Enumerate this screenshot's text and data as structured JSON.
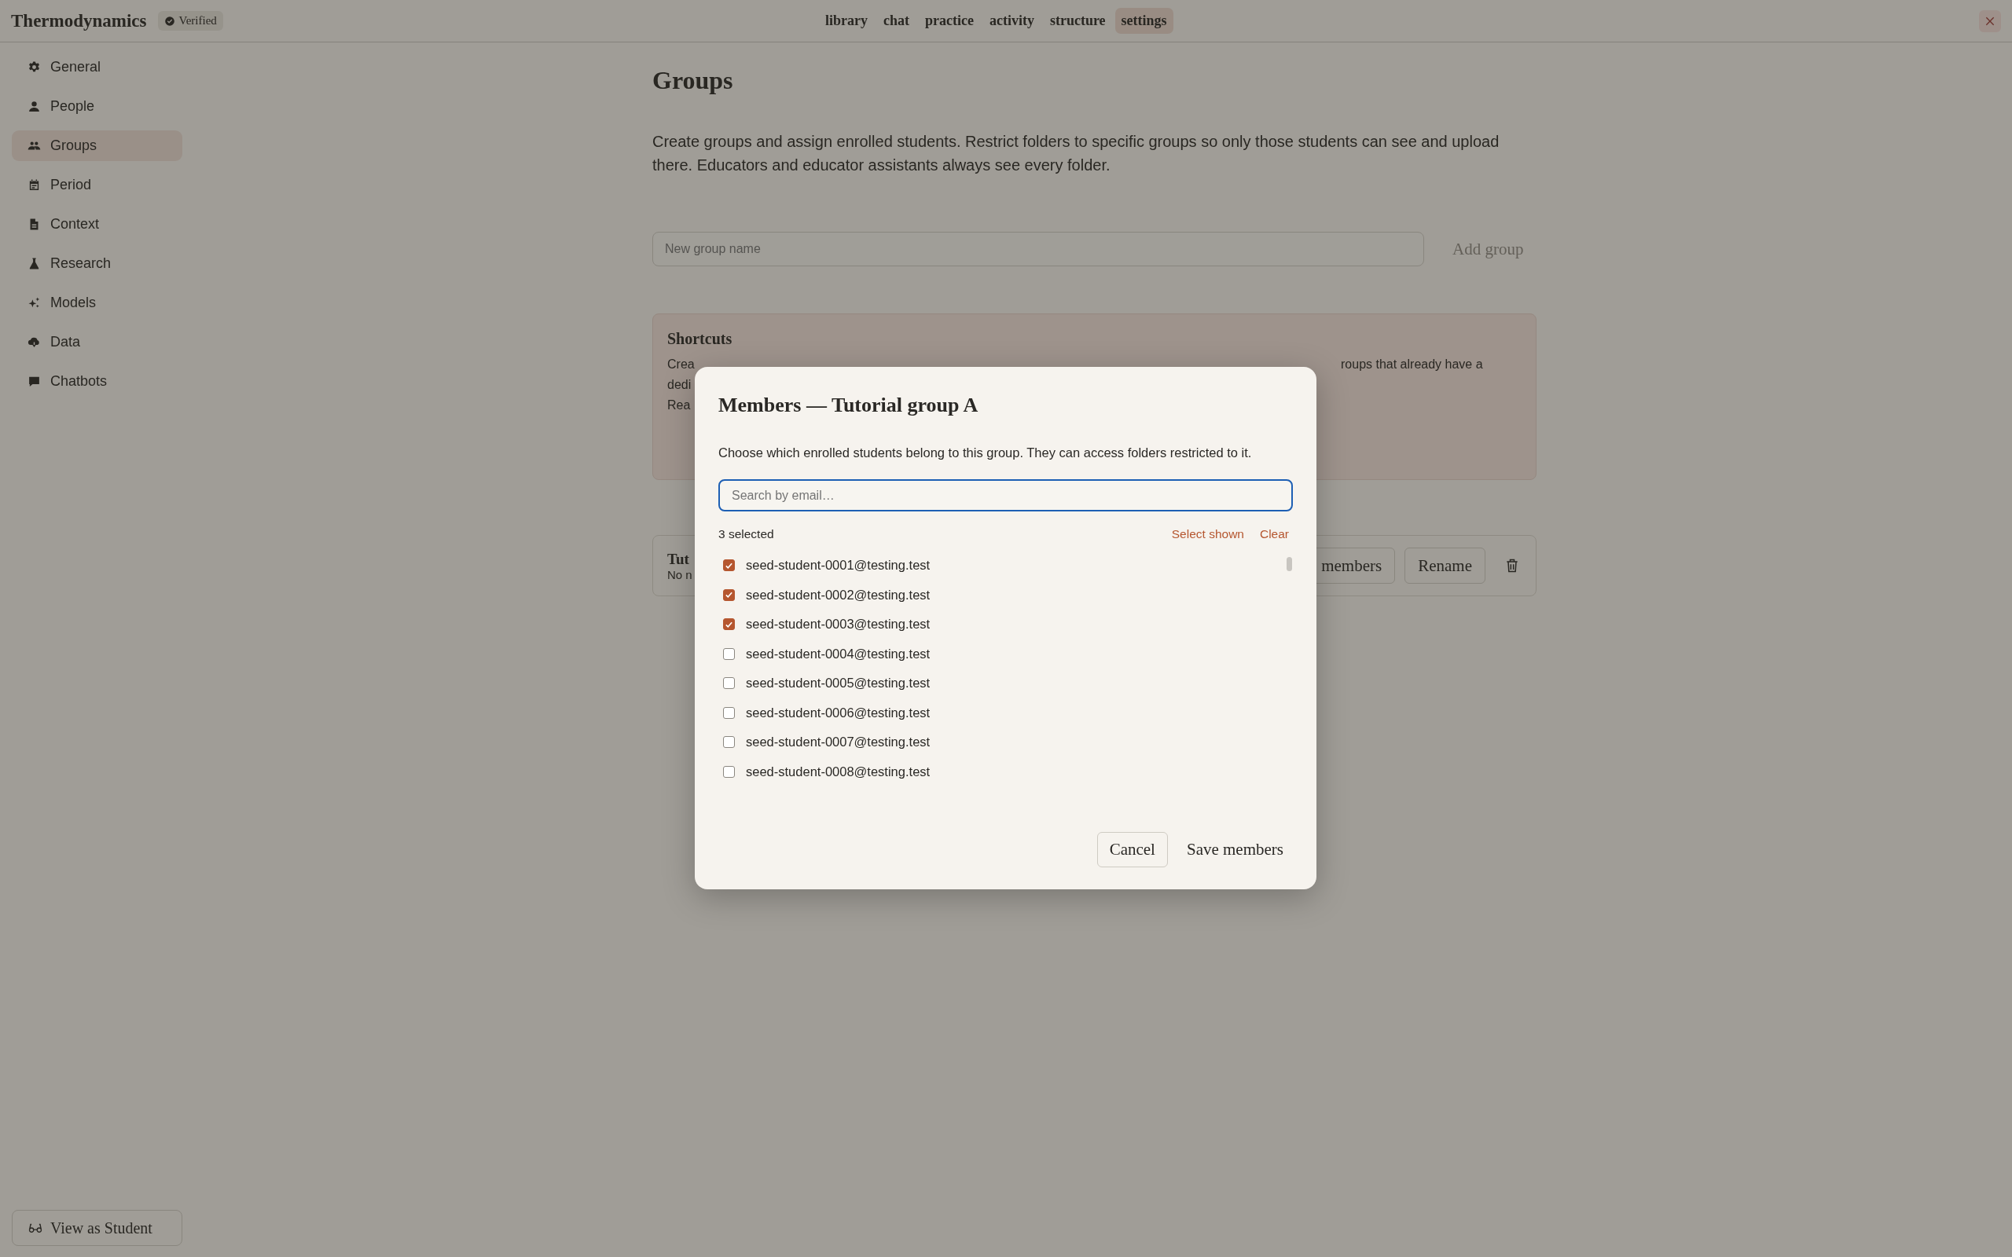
{
  "topbar": {
    "title": "Thermodynamics",
    "badge": "Verified",
    "tabs": [
      {
        "label": "library",
        "selected": false
      },
      {
        "label": "chat",
        "selected": false
      },
      {
        "label": "practice",
        "selected": false
      },
      {
        "label": "activity",
        "selected": false
      },
      {
        "label": "structure",
        "selected": false
      },
      {
        "label": "settings",
        "selected": true
      }
    ]
  },
  "sidebar": {
    "items": [
      {
        "label": "General",
        "selected": false
      },
      {
        "label": "People",
        "selected": false
      },
      {
        "label": "Groups",
        "selected": true
      },
      {
        "label": "Period",
        "selected": false
      },
      {
        "label": "Context",
        "selected": false
      },
      {
        "label": "Research",
        "selected": false
      },
      {
        "label": "Models",
        "selected": false
      },
      {
        "label": "Data",
        "selected": false
      },
      {
        "label": "Chatbots",
        "selected": false
      }
    ],
    "footer_button": "View as Student"
  },
  "page": {
    "heading": "Groups",
    "intro": "Create groups and assign enrolled students. Restrict folders to specific groups so only those students can see and upload there. Educators and educator assistants always see every folder.",
    "new_group": {
      "placeholder": "New group name",
      "button": "Add group"
    },
    "shortcuts": {
      "title": "Shortcuts",
      "left_fragments": [
        "Crea",
        "dedi",
        "Rea"
      ],
      "right_fragment": "roups that already have a"
    },
    "group_row": {
      "name_fragment": "Tut",
      "meta_fragment": "No n",
      "buttons": [
        "members",
        "Rename"
      ]
    }
  },
  "modal": {
    "title": "Members — Tutorial group A",
    "description": "Choose which enrolled students belong to this group. They can access folders restricted to it.",
    "search": {
      "placeholder": "Search by email…"
    },
    "count": "3 selected",
    "actions": [
      "Select shown",
      "Clear"
    ],
    "members": [
      {
        "email": "seed-student-0001@testing.test",
        "checked": true
      },
      {
        "email": "seed-student-0002@testing.test",
        "checked": true
      },
      {
        "email": "seed-student-0003@testing.test",
        "checked": true
      },
      {
        "email": "seed-student-0004@testing.test",
        "checked": false
      },
      {
        "email": "seed-student-0005@testing.test",
        "checked": false
      },
      {
        "email": "seed-student-0006@testing.test",
        "checked": false
      },
      {
        "email": "seed-student-0007@testing.test",
        "checked": false
      },
      {
        "email": "seed-student-0008@testing.test",
        "checked": false
      }
    ],
    "cancel": "Cancel",
    "save": "Save members"
  }
}
